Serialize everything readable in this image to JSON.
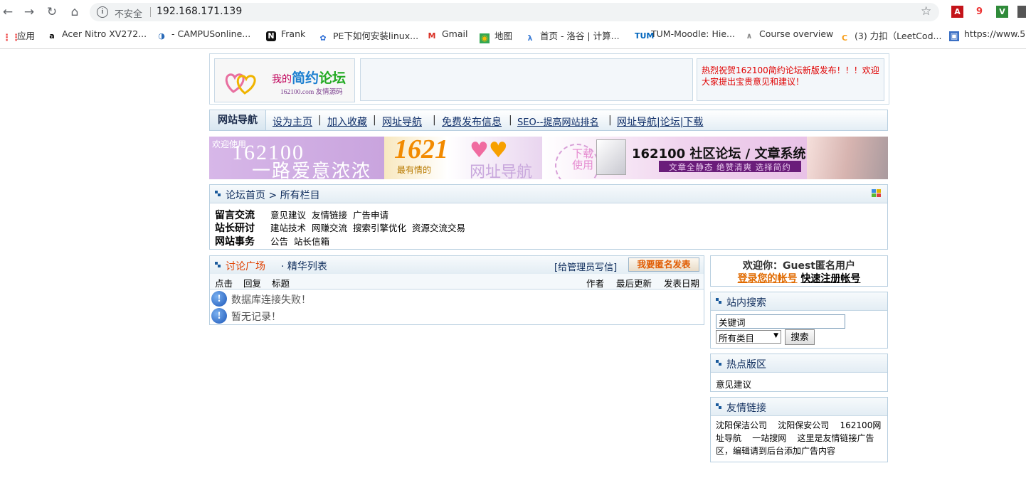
{
  "browser": {
    "insecure_label": "不安全",
    "url": "192.168.171.139",
    "bookmarks": [
      {
        "label": "应用",
        "icon": "apps-grid-icon"
      },
      {
        "label": "Acer Nitro XV272...",
        "icon": "amazon-icon"
      },
      {
        "label": "- CAMPUSonline...",
        "icon": "campusonline-icon"
      },
      {
        "label": "Frank",
        "icon": "notion-icon"
      },
      {
        "label": "PE下如何安装linux...",
        "icon": "baidu-icon"
      },
      {
        "label": "Gmail",
        "icon": "gmail-icon"
      },
      {
        "label": "地图",
        "icon": "maps-icon"
      },
      {
        "label": "首页 - 洛谷 | 计算...",
        "icon": "luogu-icon"
      },
      {
        "label": "TUM-Moodle: Hie...",
        "icon": "tum-icon"
      },
      {
        "label": "Course overview",
        "icon": "moodle-icon"
      },
      {
        "label": "(3) 力扣（LeetCod...",
        "icon": "leetcode-icon"
      },
      {
        "label": "https://www.5",
        "icon": "page-icon"
      }
    ]
  },
  "header": {
    "logo": {
      "prefix": "我的",
      "title_1": "简约",
      "title_2": "论坛",
      "sub": "162100.com 友情源码"
    },
    "notice": "热烈祝贺162100简约论坛新版发布！！！欢迎大家提出宝贵意见和建议！"
  },
  "navbar": {
    "title": "网站导航",
    "links": [
      "设为主页",
      "加入收藏",
      "网址导航",
      "免费发布信息",
      "SEO--提高网站排名",
      "网址导航|论坛|下载"
    ],
    "separator": "|"
  },
  "banner": {
    "welcome": "欢迎使用",
    "number": "162100",
    "slogan": "一路爱意浓浓",
    "brand": "1621",
    "brand_sub": "最有情的",
    "brand_nav": "网址导航",
    "dl_text": "下载使用",
    "product": "162100  社区论坛 / 文章系统",
    "tagline": "文章全静态  绝赞清爽  选择简约"
  },
  "breadcrumb": {
    "home": "论坛首页",
    "sep": ">",
    "current": "所有栏目"
  },
  "categories": [
    {
      "name": "留言交流",
      "items": [
        "意见建议",
        "友情链接",
        "广告申请"
      ]
    },
    {
      "name": "站长研讨",
      "items": [
        "建站技术",
        "网赚交流",
        "搜索引擎优化",
        "资源交流交易"
      ]
    },
    {
      "name": "网站事务",
      "items": [
        "公告",
        "站长信箱"
      ]
    }
  ],
  "discussion": {
    "tab_active": "讨论广场",
    "tab_other": "· 精华列表",
    "write_admin": "[给管理员写信]",
    "post_anon": "我要匿名发表",
    "columns": {
      "clicks": "点击",
      "replies": "回复",
      "title": "标题",
      "author": "作者",
      "last_update": "最后更新",
      "post_date": "发表日期"
    },
    "messages": [
      "数据库连接失败！",
      "暂无记录！"
    ]
  },
  "sidebar": {
    "welcome": "欢迎你：Guest匿名用户",
    "login": "登录您的帐号",
    "register": "快速注册帐号",
    "search": {
      "title": "站内搜索",
      "keyword": "关键词",
      "select": "所有类目",
      "button": "搜索"
    },
    "hot": {
      "title": "热点版区",
      "items": [
        "意见建议"
      ]
    },
    "links": {
      "title": "友情链接",
      "text": "沈阳保洁公司    沈阳保安公司    162100网址导航    一站搜网    这里是友情链接广告区，编辑请到后台添加广告内容"
    }
  },
  "colors": {
    "accent_red": "#e00000",
    "link_orange": "#e06a00",
    "nav_blue": "#0c2b66",
    "border": "#b8cfe0"
  }
}
